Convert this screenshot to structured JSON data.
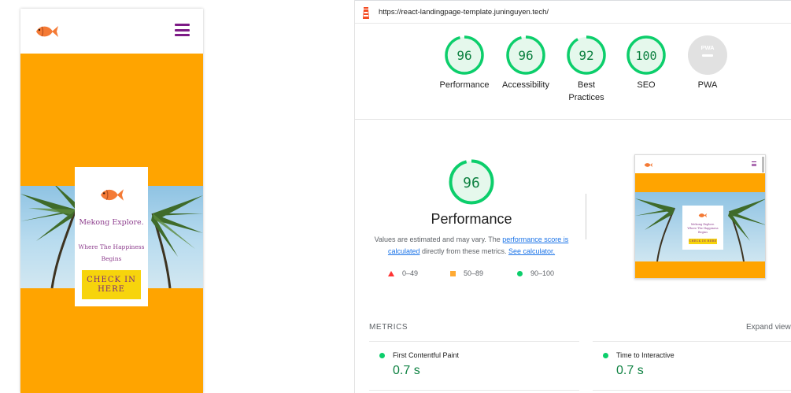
{
  "preview": {
    "colors": {
      "background": "#ffa400",
      "accent": "#7d1b86",
      "button": "#f7d40c"
    },
    "card": {
      "title": "Mekong Explore.",
      "subtitle": "Where The Happiness Begins",
      "button_label": "CHECK IN HERE"
    }
  },
  "report": {
    "url": "https://react-landingpage-template.juninguyen.tech/",
    "categories": [
      {
        "label": "Performance",
        "score": "96",
        "status": "pass"
      },
      {
        "label": "Accessibility",
        "score": "96",
        "status": "pass"
      },
      {
        "label": "Best Practices",
        "score": "92",
        "status": "pass"
      },
      {
        "label": "SEO",
        "score": "100",
        "status": "pass"
      },
      {
        "label": "PWA",
        "score": "PWA",
        "status": "na"
      }
    ],
    "performance": {
      "score": "96",
      "title": "Performance",
      "desc_1": "Values are estimated and may vary. The ",
      "link_1": "performance score is calculated",
      "desc_2": " directly from these metrics. ",
      "link_2": "See calculator."
    },
    "legend": {
      "fail": "0–49",
      "average": "50–89",
      "pass": "90–100"
    },
    "metrics_label": "METRICS",
    "expand_label": "Expand view",
    "metrics": [
      {
        "name": "First Contentful Paint",
        "value": "0.7 s"
      },
      {
        "name": "Time to Interactive",
        "value": "0.7 s"
      }
    ],
    "colors": {
      "pass": "#0cce6b",
      "pass_text": "#0c8040",
      "average": "#ffaa33",
      "fail": "#ff3333"
    }
  }
}
